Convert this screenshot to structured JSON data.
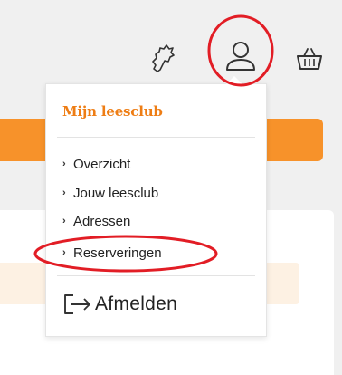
{
  "header": {
    "icons": [
      "map-icon",
      "user-icon",
      "basket-icon"
    ]
  },
  "dropdown": {
    "title": "Mijn leesclub",
    "items": [
      {
        "label": "Overzicht"
      },
      {
        "label": "Jouw leesclub"
      },
      {
        "label": "Adressen"
      },
      {
        "label": "Reserveringen"
      }
    ],
    "logout_label": "Afmelden",
    "logout_icon": "logout-icon"
  },
  "colors": {
    "brand_orange": "#f7922a",
    "title_orange": "#ee7d14",
    "notice_bg": "#fdf1e3",
    "annotation_red": "#e21d25"
  }
}
